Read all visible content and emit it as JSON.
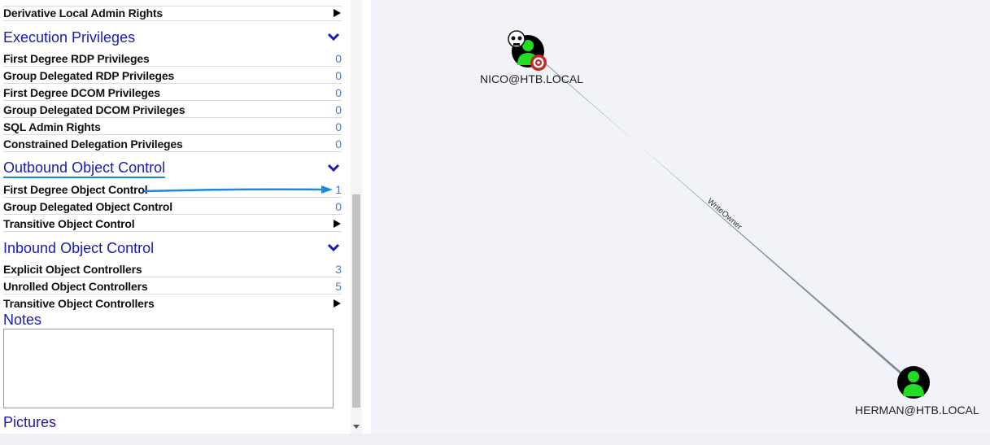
{
  "panel": {
    "top_partial_row": {
      "label": "Derivative Local Admin Rights"
    },
    "sections": {
      "execution": {
        "title": "Execution Privileges",
        "rows": [
          {
            "label": "First Degree RDP Privileges",
            "count": "0"
          },
          {
            "label": "Group Delegated RDP Privileges",
            "count": "0"
          },
          {
            "label": "First Degree DCOM Privileges",
            "count": "0"
          },
          {
            "label": "Group Delegated DCOM Privileges",
            "count": "0"
          },
          {
            "label": "SQL Admin Rights",
            "count": "0"
          },
          {
            "label": "Constrained Delegation Privileges",
            "count": "0"
          }
        ]
      },
      "outbound": {
        "title": "Outbound Object Control",
        "rows": [
          {
            "label": "First Degree Object Control",
            "count": "1"
          },
          {
            "label": "Group Delegated Object Control",
            "count": "0"
          },
          {
            "label": "Transitive Object Control"
          }
        ]
      },
      "inbound": {
        "title": "Inbound Object Control",
        "rows": [
          {
            "label": "Explicit Object Controllers",
            "count": "3"
          },
          {
            "label": "Unrolled Object Controllers",
            "count": "5"
          },
          {
            "label": "Transitive Object Controllers"
          }
        ]
      }
    },
    "notes": {
      "title": "Notes",
      "value": ""
    },
    "pictures": {
      "title": "Pictures"
    }
  },
  "graph": {
    "nodes": {
      "source": {
        "label": "NICO@HTB.LOCAL",
        "icon": "user-icon",
        "badges": [
          "skull-icon",
          "target-icon"
        ]
      },
      "target": {
        "label": "HERMAN@HTB.LOCAL",
        "icon": "user-icon"
      }
    },
    "edge": {
      "label": "WriteOwner"
    }
  },
  "colors": {
    "section_title": "#1a1ab4",
    "count": "#4b7bbd",
    "highlight_arrow": "#1e88e5",
    "node_green": "#22dd22",
    "edge": "#7d8f99",
    "graph_bg": "#f1f3f8"
  }
}
